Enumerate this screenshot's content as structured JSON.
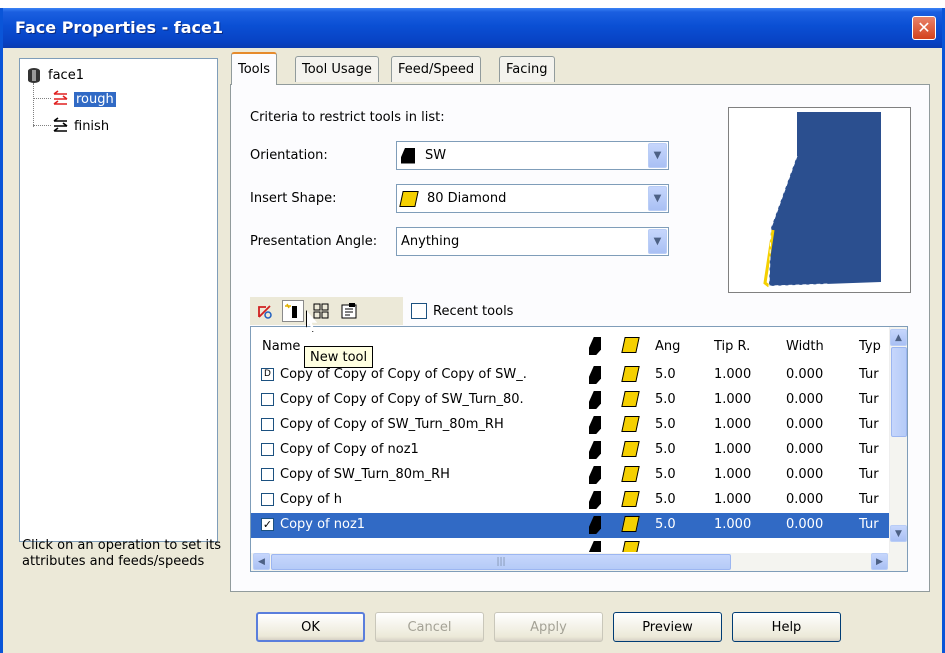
{
  "window": {
    "title": "Face Properties - face1",
    "close_glyph": "✕"
  },
  "tree": {
    "root_label": "face1",
    "items": [
      {
        "label": "rough"
      },
      {
        "label": "finish"
      }
    ]
  },
  "help_text": "Click on an operation to set its attributes and feeds/speeds",
  "tabs": [
    {
      "label": "Tools"
    },
    {
      "label": "Tool Usage"
    },
    {
      "label": "Feed/Speed"
    },
    {
      "label": "Facing"
    }
  ],
  "criteria": {
    "heading": "Criteria to restrict tools in list:",
    "orientation_label": "Orientation:",
    "orientation_value": "SW",
    "insert_label": "Insert Shape:",
    "insert_value": "80 Diamond",
    "angle_label": "Presentation Angle:",
    "angle_value": "Anything"
  },
  "toolbar": {
    "recent_label": "Recent tools",
    "tooltip": "New tool"
  },
  "list": {
    "columns": {
      "name": "Name",
      "ang": "Ang",
      "tip": "Tip R.",
      "width": "Width",
      "type": "Typ"
    },
    "rows": [
      {
        "checkbox": "D",
        "name": "Copy of Copy of Copy of Copy of SW_.",
        "ang": "5.0",
        "tip": "1.000",
        "width": "0.000",
        "type": "Tur"
      },
      {
        "checkbox": "",
        "name": "Copy of Copy of Copy of SW_Turn_80.",
        "ang": "5.0",
        "tip": "1.000",
        "width": "0.000",
        "type": "Tur"
      },
      {
        "checkbox": "",
        "name": "Copy of Copy of SW_Turn_80m_RH",
        "ang": "5.0",
        "tip": "1.000",
        "width": "0.000",
        "type": "Tur"
      },
      {
        "checkbox": "",
        "name": "Copy of Copy of noz1",
        "ang": "5.0",
        "tip": "1.000",
        "width": "0.000",
        "type": "Tur"
      },
      {
        "checkbox": "",
        "name": "Copy of SW_Turn_80m_RH",
        "ang": "5.0",
        "tip": "1.000",
        "width": "0.000",
        "type": "Tur"
      },
      {
        "checkbox": "",
        "name": "Copy of h",
        "ang": "5.0",
        "tip": "1.000",
        "width": "0.000",
        "type": "Tur"
      },
      {
        "checkbox": "✓",
        "name": "Copy of noz1",
        "ang": "5.0",
        "tip": "1.000",
        "width": "0.000",
        "type": "Tur"
      }
    ]
  },
  "buttons": {
    "ok": "OK",
    "cancel": "Cancel",
    "apply": "Apply",
    "preview": "Preview",
    "help": "Help"
  },
  "colors": {
    "selection": "#316ac5",
    "insert_yellow": "#f5d000",
    "tool_blue": "#2b4f8f"
  }
}
